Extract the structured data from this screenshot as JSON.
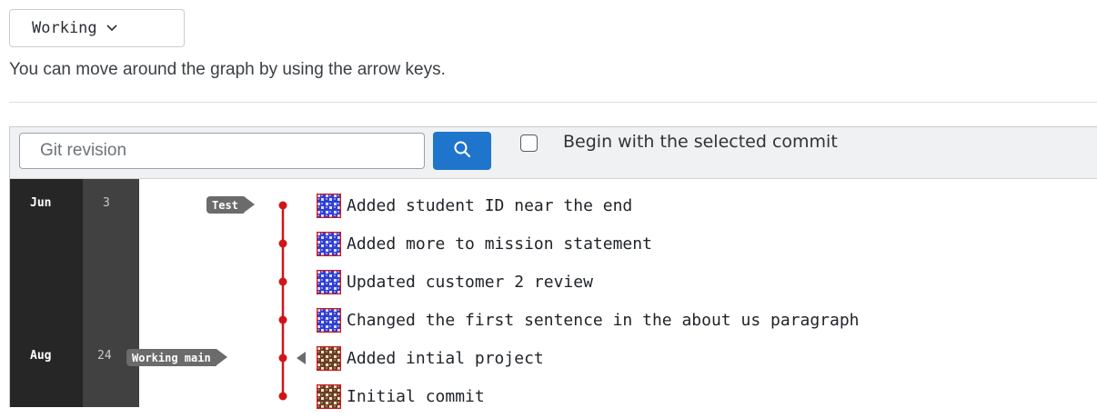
{
  "branch_selector": {
    "label": "Working"
  },
  "hint": {
    "text": "You can move around the graph by using the arrow keys."
  },
  "toolbar": {
    "search_placeholder": "Git revision",
    "checkbox_label": "Begin with the selected commit"
  },
  "dates": [
    {
      "month": "Jun",
      "day": "3"
    },
    {
      "month": "Aug",
      "day": "24"
    }
  ],
  "refs": [
    {
      "name": "Test"
    },
    {
      "name": "Working main"
    }
  ],
  "commits": [
    {
      "message": "Added student ID near the end",
      "avatar": "blue-pattern-avatar"
    },
    {
      "message": "Added more to mission statement",
      "avatar": "blue-pattern-avatar"
    },
    {
      "message": "Updated customer 2 review",
      "avatar": "blue-pattern-avatar"
    },
    {
      "message": "Changed the first sentence in the about us paragraph",
      "avatar": "blue-pattern-avatar"
    },
    {
      "message": "Added intial project",
      "avatar": "brown-pattern-avatar"
    },
    {
      "message": "Initial commit",
      "avatar": "brown-pattern-avatar"
    }
  ],
  "colors": {
    "graph_line": "#d0151a",
    "search_button": "#1f75cb",
    "month_column": "#262626",
    "day_column": "#414141",
    "ref_tag": "#6b6b6b",
    "avatar_blue": "#2f3fd0",
    "avatar_brown": "#6a3d25"
  }
}
